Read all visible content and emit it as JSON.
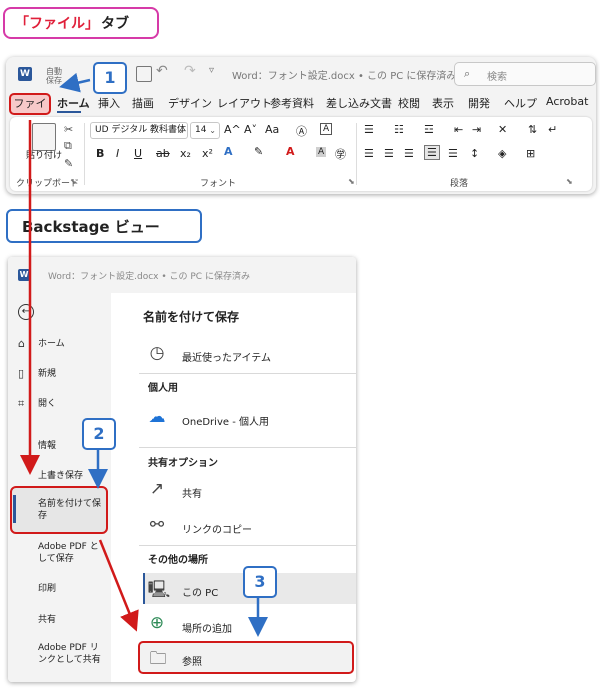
{
  "callouts": {
    "file_tab": {
      "quote_open": "「",
      "word": "ファイル",
      "quote_close": "」",
      "suffix": "タブ"
    },
    "backstage": "Backstage ビュー"
  },
  "steps": [
    "1",
    "2",
    "3"
  ],
  "ribbon": {
    "autosave": "自動\n保存",
    "doc_title": "Word：フォント設定.docx • この PC に保存済み ∨",
    "search_placeholder": "検索",
    "tabs": [
      "ファイル",
      "ホーム",
      "挿入",
      "描画",
      "デザイン",
      "レイアウト",
      "参考資料",
      "差し込み文書",
      "校閲",
      "表示",
      "開発",
      "ヘルプ",
      "Acrobat"
    ],
    "clipboard": {
      "paste_label": "貼り付け",
      "group_label": "クリップボード"
    },
    "font": {
      "font_name": "UD デジタル 教科書体",
      "font_size": "14",
      "group_label": "フォント",
      "grow": "A^",
      "shrink": "A˅",
      "case": "Aa",
      "bold": "B",
      "italic": "I",
      "underline": "U",
      "strike": "ab",
      "subscript": "x₂",
      "superscript": "x²"
    },
    "paragraph": {
      "group_label": "段落"
    }
  },
  "backstage": {
    "title": "Word：フォント設定.docx • この PC に保存済み",
    "nav": {
      "home": "ホーム",
      "new": "新規",
      "open": "開く",
      "info": "情報",
      "overwrite": "上書き保存",
      "save_as": "名前を付けて保\n存",
      "adobe_pdf_save": "Adobe PDF と\nして保存",
      "print": "印刷",
      "share": "共有",
      "adobe_pdf_share": "Adobe PDF リ\nンクとして共有"
    },
    "main": {
      "heading": "名前を付けて保存",
      "recent": "最近使ったアイテム",
      "personal_section": "個人用",
      "onedrive": "OneDrive - 個人用",
      "share_section": "共有オプション",
      "share": "共有",
      "copy_link": "リンクのコピー",
      "other_section": "その他の場所",
      "this_pc": "この PC",
      "add_place": "場所の追加",
      "browse": "参照"
    }
  },
  "colors": {
    "accent_blue": "#2f6fc4",
    "highlight_red": "#d11a1a",
    "callout_pink": "#d63aa8",
    "word_blue": "#2b579a"
  }
}
